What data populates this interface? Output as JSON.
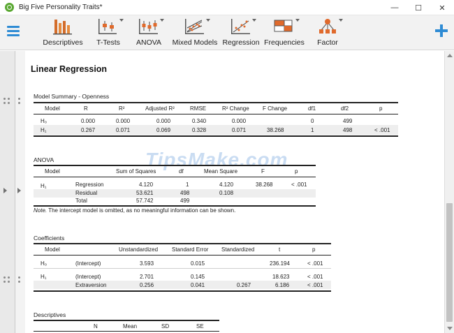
{
  "window": {
    "title": "Big Five Personality Traits*",
    "minimize": "—",
    "maximize": "☐",
    "close": "✕"
  },
  "ribbon": {
    "tools": [
      {
        "name": "descriptives",
        "label": "Descriptives",
        "icon": "bar-chart-icon",
        "has_menu": false
      },
      {
        "name": "t-tests",
        "label": "T-Tests",
        "icon": "t-test-icon",
        "has_menu": true
      },
      {
        "name": "anova",
        "label": "ANOVA",
        "icon": "anova-icon",
        "has_menu": true
      },
      {
        "name": "mixed-models",
        "label": "Mixed Models",
        "icon": "mixed-models-icon",
        "has_menu": true
      },
      {
        "name": "regression",
        "label": "Regression",
        "icon": "regression-icon",
        "has_menu": true
      },
      {
        "name": "frequencies",
        "label": "Frequencies",
        "icon": "frequencies-icon",
        "has_menu": true
      },
      {
        "name": "factor",
        "label": "Factor",
        "icon": "factor-icon",
        "has_menu": true
      }
    ],
    "accent": "#2e8bd4"
  },
  "results": {
    "heading": "Linear Regression",
    "watermark": "TipsMake.com",
    "model_summary": {
      "title": "Model Summary - Openness",
      "columns": [
        "Model",
        "R",
        "R²",
        "Adjusted R²",
        "RMSE",
        "R² Change",
        "F Change",
        "df1",
        "df2",
        "p"
      ],
      "rows": [
        {
          "model": "H₀",
          "r": "0.000",
          "r2": "0.000",
          "adj_r2": "0.000",
          "rmse": "0.340",
          "r2_change": "0.000",
          "f_change": "",
          "df1": "0",
          "df2": "499",
          "p": ""
        },
        {
          "model": "H₁",
          "r": "0.267",
          "r2": "0.071",
          "adj_r2": "0.069",
          "rmse": "0.328",
          "r2_change": "0.071",
          "f_change": "38.268",
          "df1": "1",
          "df2": "498",
          "p": "< .001"
        }
      ]
    },
    "anova": {
      "title": "ANOVA",
      "columns": [
        "Model",
        "",
        "Sum of Squares",
        "df",
        "Mean Square",
        "F",
        "p"
      ],
      "model": "H₁",
      "rows": [
        {
          "term": "Regression",
          "ss": "4.120",
          "df": "1",
          "ms": "4.120",
          "f": "38.268",
          "p": "< .001"
        },
        {
          "term": "Residual",
          "ss": "53.621",
          "df": "498",
          "ms": "0.108",
          "f": "",
          "p": ""
        },
        {
          "term": "Total",
          "ss": "57.742",
          "df": "499",
          "ms": "",
          "f": "",
          "p": ""
        }
      ],
      "note_label": "Note.",
      "note_text": " The intercept model is omitted, as no meaningful information can be shown."
    },
    "coefficients": {
      "title": "Coefficients",
      "columns": [
        "Model",
        "",
        "Unstandardized",
        "Standard Error",
        "Standardized",
        "t",
        "p"
      ],
      "rows": [
        {
          "model": "H₀",
          "term": "(Intercept)",
          "unstd": "3.593",
          "se": "0.015",
          "std": "",
          "t": "236.194",
          "p": "< .001"
        },
        {
          "model": "H₁",
          "term": "(Intercept)",
          "unstd": "2.701",
          "se": "0.145",
          "std": "",
          "t": "18.623",
          "p": "< .001"
        },
        {
          "model": "",
          "term": "Extraversion",
          "unstd": "0.256",
          "se": "0.041",
          "std": "0.267",
          "t": "6.186",
          "p": "< .001"
        }
      ]
    },
    "descriptives": {
      "title": "Descriptives",
      "columns": [
        "",
        "N",
        "Mean",
        "SD",
        "SE"
      ]
    }
  }
}
